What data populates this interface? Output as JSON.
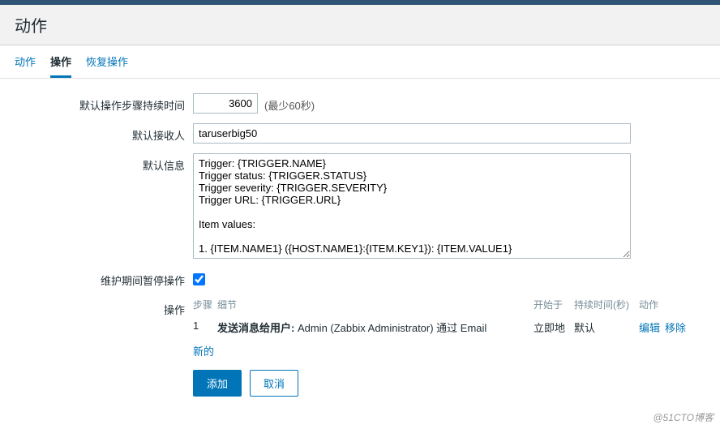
{
  "header": {
    "title": "动作"
  },
  "tabs": [
    {
      "label": "动作",
      "active": false
    },
    {
      "label": "操作",
      "active": true
    },
    {
      "label": "恢复操作",
      "active": false
    }
  ],
  "form": {
    "step_duration": {
      "label": "默认操作步骤持续时间",
      "value": "3600",
      "hint": "(最少60秒)"
    },
    "recipient": {
      "label": "默认接收人",
      "value": "taruserbig50"
    },
    "message": {
      "label": "默认信息",
      "value": "Trigger: {TRIGGER.NAME}\nTrigger status: {TRIGGER.STATUS}\nTrigger severity: {TRIGGER.SEVERITY}\nTrigger URL: {TRIGGER.URL}\n\nItem values:\n\n1. {ITEM.NAME1} ({HOST.NAME1}:{ITEM.KEY1}): {ITEM.VALUE1}"
    },
    "pause_maint": {
      "label": "维护期间暂停操作",
      "checked": true
    },
    "operations": {
      "label": "操作",
      "headers": {
        "step": "步骤",
        "detail": "细节",
        "start": "开始于",
        "duration": "持续时间(秒)",
        "action": "动作"
      },
      "rows": [
        {
          "step": "1",
          "detail_bold": "发送消息给用户:",
          "detail_rest": " Admin (Zabbix Administrator) 通过 Email",
          "start": "立即地",
          "duration": "默认",
          "edit": "编辑",
          "remove": "移除"
        }
      ],
      "new_label": "新的"
    },
    "buttons": {
      "add": "添加",
      "cancel": "取消"
    }
  },
  "watermark": "@51CTO博客"
}
